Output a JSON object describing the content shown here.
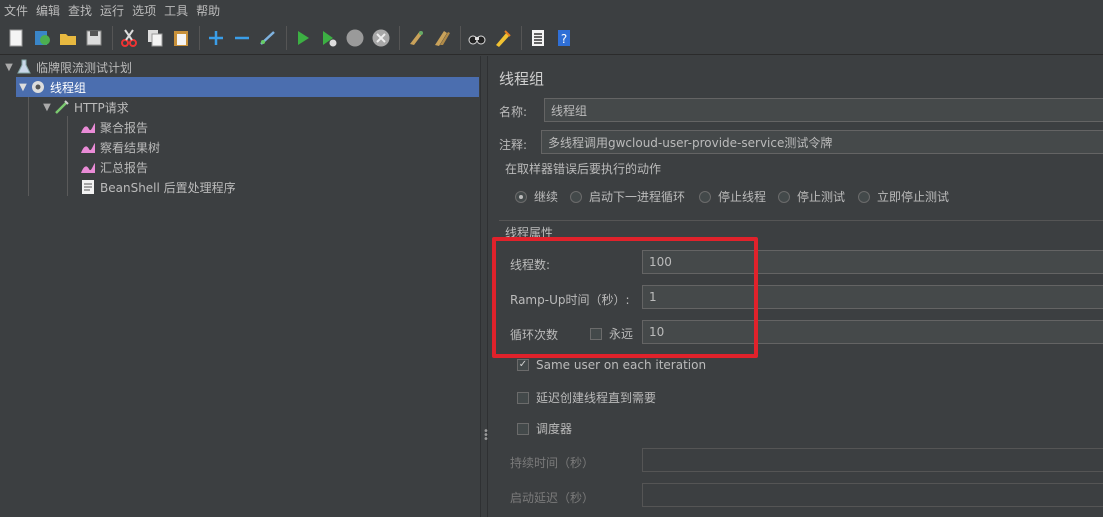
{
  "menu": [
    "文件",
    "编辑",
    "查找",
    "运行",
    "选项",
    "工具",
    "帮助"
  ],
  "toolbar_icons": [
    "new-icon",
    "templates-icon",
    "open-icon",
    "save-icon",
    "cut-icon",
    "copy-icon",
    "paste-icon",
    "expand-icon",
    "collapse-icon",
    "toggle-icon",
    "start-icon",
    "start-no-pause-icon",
    "stop-icon",
    "shutdown-icon",
    "clear-icon",
    "clear-all-icon",
    "search-icon",
    "reset-search-icon",
    "function-helper-icon",
    "help-icon"
  ],
  "tree": {
    "root": "临牌限流测试计划",
    "thread_group": "线程组",
    "http": "HTTP请求",
    "agg": "聚合报告",
    "view": "察看结果树",
    "summary": "汇总报告",
    "beanshell": "BeanShell 后置处理程序"
  },
  "panel": {
    "title": "线程组",
    "name_label": "名称:",
    "name_value": "线程组",
    "comment_label": "注释:",
    "comment_value": "多线程调用gwcloud-user-provide-service测试令牌",
    "error_group": "在取样器错误后要执行的动作",
    "actions": [
      "继续",
      "启动下一进程循环",
      "停止线程",
      "停止测试",
      "立即停止测试"
    ],
    "selected_action": "继续",
    "props_group": "线程属性",
    "threads_label": "线程数:",
    "threads_value": "100",
    "rampup_label": "Ramp-Up时间（秒）:",
    "rampup_value": "1",
    "loop_label": "循环次数",
    "forever_label": "永远",
    "loop_value": "10",
    "same_user": "Same user on each iteration",
    "delay_create": "延迟创建线程直到需要",
    "scheduler": "调度器",
    "duration_label": "持续时间（秒）",
    "startup_delay_label": "启动延迟（秒）"
  },
  "colors": {
    "highlight": "#e0222b",
    "selection": "#4b6eaf"
  }
}
